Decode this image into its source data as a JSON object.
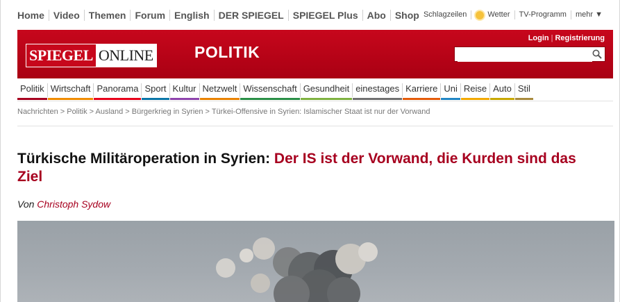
{
  "topnav": {
    "items": [
      "Home",
      "Video",
      "Themen",
      "Forum",
      "English",
      "DER SPIEGEL",
      "SPIEGEL Plus",
      "Abo",
      "Shop"
    ],
    "right": {
      "headlines": "Schlagzeilen",
      "weather": "Wetter",
      "tv": "TV-Programm",
      "more": "mehr ▼"
    }
  },
  "header": {
    "logo_left": "SPIEGEL",
    "logo_right": "ONLINE",
    "section": "POLITIK",
    "login": "Login",
    "register": "Registrierung",
    "login_sep": "|",
    "search_value": ""
  },
  "sections": [
    {
      "label": "Politik",
      "color": "#a7001f"
    },
    {
      "label": "Wirtschaft",
      "color": "#f08c00"
    },
    {
      "label": "Panorama",
      "color": "#e7001a"
    },
    {
      "label": "Sport",
      "color": "#0a76a8"
    },
    {
      "label": "Kultur",
      "color": "#8e44ad"
    },
    {
      "label": "Netzwelt",
      "color": "#e98200"
    },
    {
      "label": "Wissenschaft",
      "color": "#2a8f47"
    },
    {
      "label": "Gesundheit",
      "color": "#7fb241"
    },
    {
      "label": "einestages",
      "color": "#707070"
    },
    {
      "label": "Karriere",
      "color": "#e45b0a"
    },
    {
      "label": "Uni",
      "color": "#2186c4"
    },
    {
      "label": "Reise",
      "color": "#f2a900"
    },
    {
      "label": "Auto",
      "color": "#c8a800"
    },
    {
      "label": "Stil",
      "color": "#a88a3d"
    }
  ],
  "breadcrumb": "Nachrichten > Politik > Ausland > Bürgerkrieg in Syrien > Türkei-Offensive in Syrien: Islamischer Staat ist nur der Vorwand",
  "article": {
    "headline_black": "Türkische Militäroperation in Syrien: ",
    "headline_red": "Der IS ist der Vorwand, die Kurden sind das Ziel",
    "byline_prefix": "Von ",
    "author": "Christoph Sydow"
  },
  "colors": {
    "brand_red": "#c7071c",
    "headline_red": "#a7001f"
  }
}
